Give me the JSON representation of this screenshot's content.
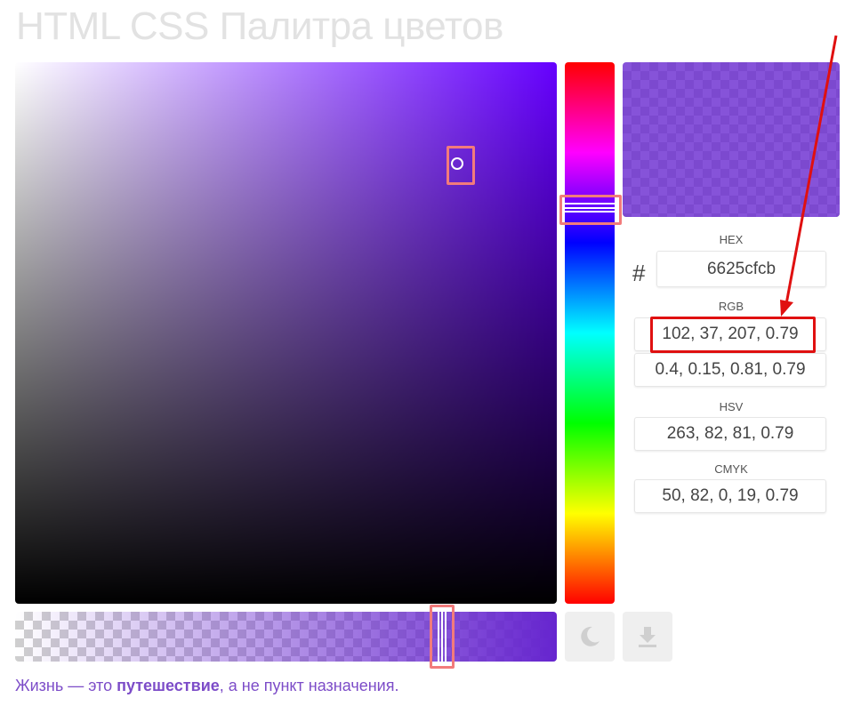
{
  "page": {
    "title": "HTML CSS Палитра цветов"
  },
  "picker": {
    "hue_color": "#6600ff",
    "selected_color": "#6625cf",
    "alpha": 0.79
  },
  "fields": {
    "hex": {
      "label": "HEX",
      "prefix": "#",
      "value": "6625cfcb"
    },
    "rgb": {
      "label": "RGB",
      "value": "102, 37, 207, 0.79",
      "normalized": "0.4, 0.15, 0.81, 0.79"
    },
    "hsv": {
      "label": "HSV",
      "value": "263, 82, 81, 0.79"
    },
    "cmyk": {
      "label": "CMYK",
      "value": "50, 82, 0, 19, 0.79"
    }
  },
  "buttons": {
    "theme_icon": "moon-icon",
    "download_icon": "download-icon"
  },
  "quote": {
    "before": "Жизнь — это ",
    "bold": "путешествие",
    "after": ", а не пункт назначения."
  },
  "colors": {
    "highlight_red": "#e01010",
    "marker_pink": "#f27b7b",
    "quote_purple": "#7c4cc8"
  }
}
